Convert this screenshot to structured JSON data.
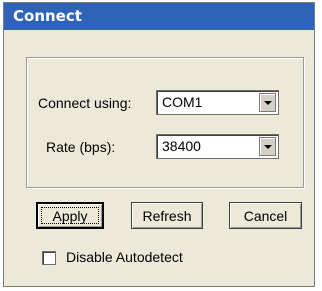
{
  "window": {
    "title": "Connect"
  },
  "connection": {
    "connect_using_label": "Connect using:",
    "connect_using_value": "COM1",
    "rate_label": "Rate (bps):",
    "rate_value": "38400"
  },
  "buttons": {
    "apply": "Apply",
    "refresh": "Refresh",
    "cancel": "Cancel"
  },
  "autodetect": {
    "label": "Disable Autodetect",
    "checked": false
  },
  "icons": {
    "dropdown": "chevron-down-icon"
  },
  "colors": {
    "title_bar": "#2f63b8",
    "dialog_background": "#ece9d8"
  }
}
